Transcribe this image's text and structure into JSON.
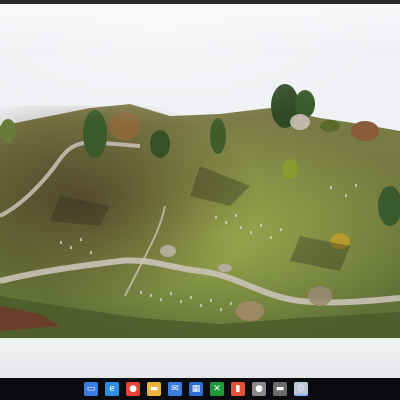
{
  "app": {
    "viewport_content": "3D photogrammetry terrain model"
  },
  "taskbar": {
    "icons": [
      {
        "name": "file-explorer",
        "glyph": "▭",
        "color": "#3b7de0"
      },
      {
        "name": "edge-browser",
        "glyph": "e",
        "color": "#2f8fe6"
      },
      {
        "name": "chrome-browser",
        "glyph": "●",
        "color": "#e94335"
      },
      {
        "name": "folder",
        "glyph": "▬",
        "color": "#e8b33a"
      },
      {
        "name": "mail",
        "glyph": "✉",
        "color": "#3c7fe0"
      },
      {
        "name": "store",
        "glyph": "▦",
        "color": "#2d6fd0"
      },
      {
        "name": "xbox",
        "glyph": "✕",
        "color": "#1f9a3b"
      },
      {
        "name": "office",
        "glyph": "▮",
        "color": "#e0553a"
      },
      {
        "name": "app-circle",
        "glyph": "●",
        "color": "#8a8a8a"
      },
      {
        "name": "terminal",
        "glyph": "▬",
        "color": "#6a6a6a"
      },
      {
        "name": "3d-viewer",
        "glyph": "◇",
        "color": "#bfc7d4"
      }
    ]
  }
}
